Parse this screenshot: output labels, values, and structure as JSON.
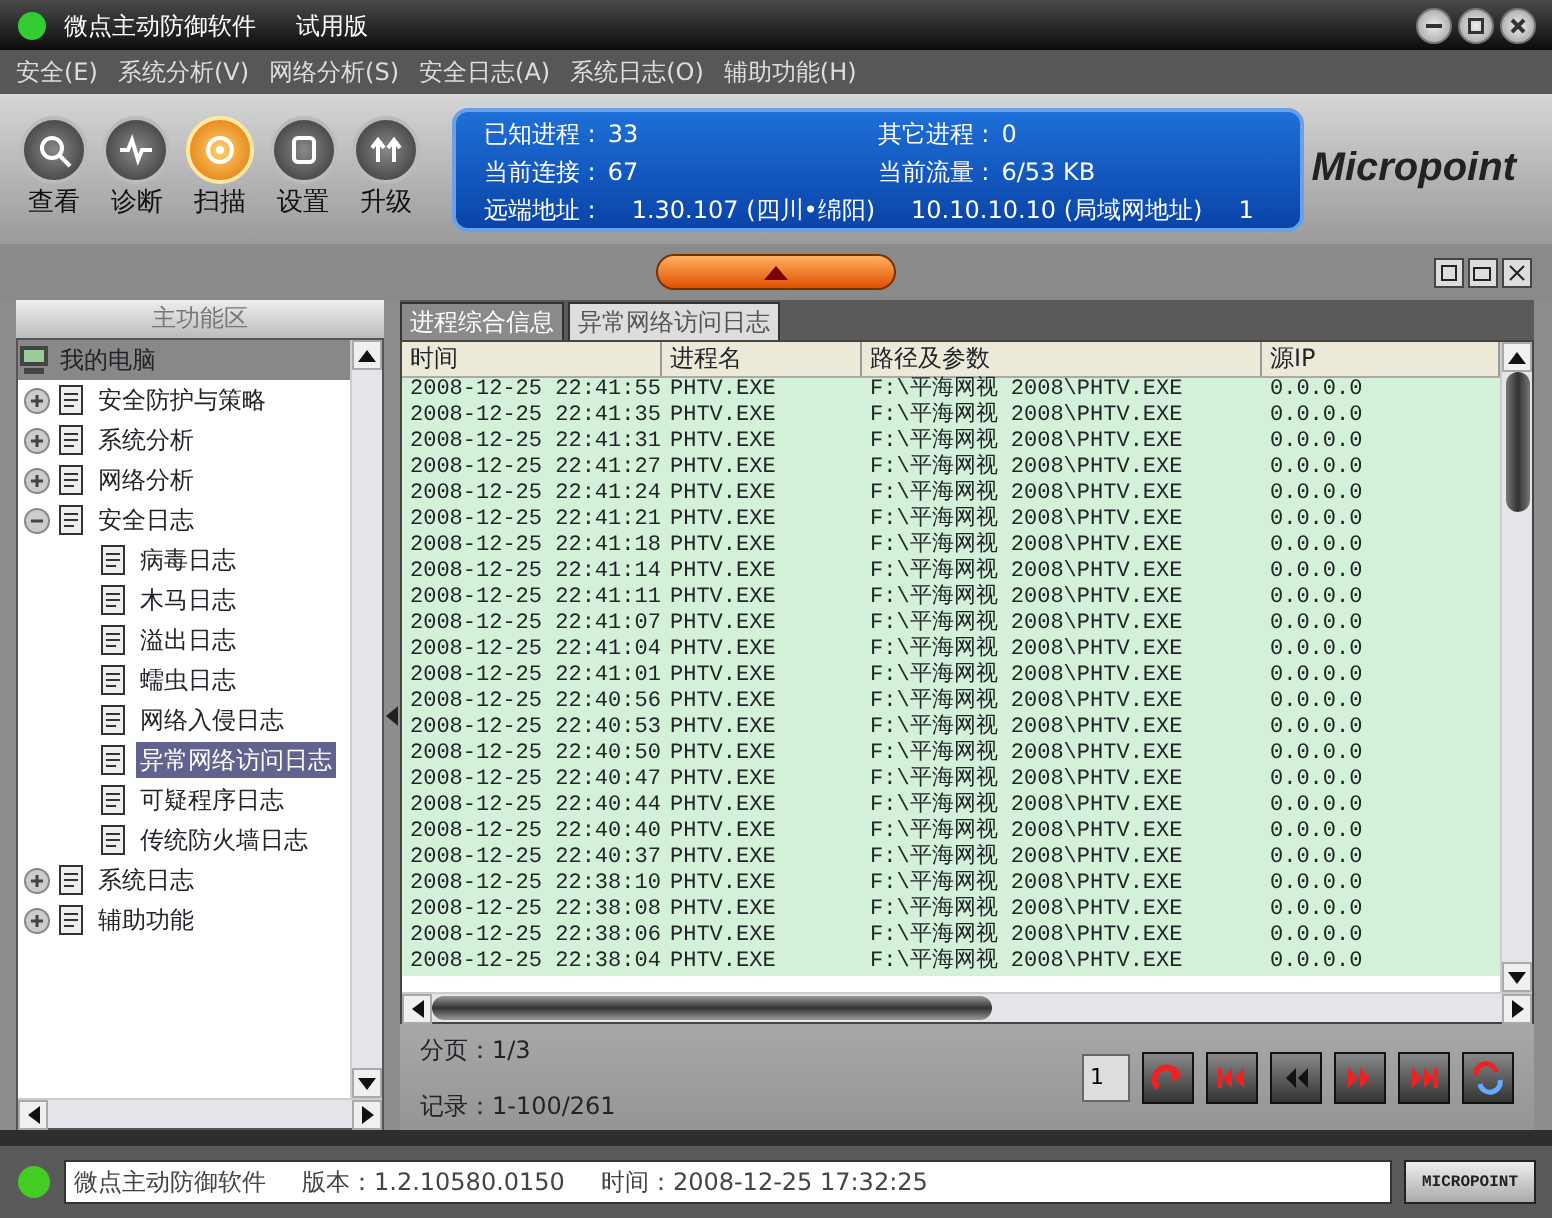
{
  "window": {
    "title": "微点主动防御软件",
    "edition": "试用版"
  },
  "menu": [
    "安全(E)",
    "系统分析(V)",
    "网络分析(S)",
    "安全日志(A)",
    "系统日志(O)",
    "辅助功能(H)"
  ],
  "toolbar": [
    {
      "label": "查看",
      "kind": "view",
      "selected": false
    },
    {
      "label": "诊断",
      "kind": "diagnose",
      "selected": false
    },
    {
      "label": "扫描",
      "kind": "scan",
      "selected": true
    },
    {
      "label": "设置",
      "kind": "settings",
      "selected": false
    },
    {
      "label": "升级",
      "kind": "upgrade",
      "selected": false
    }
  ],
  "info_panel": {
    "fields": [
      {
        "label": "已知进程 :",
        "value": "33"
      },
      {
        "label": "其它进程 :",
        "value": "0"
      },
      {
        "label": "当前连接 :",
        "value": "67"
      },
      {
        "label": "当前流量 :",
        "value": "6/53 KB"
      }
    ],
    "remote": {
      "label": "远端地址 :",
      "values": [
        "1.30.107 (四川•绵阳)",
        "10.10.10.10 (局域网地址)",
        "1"
      ]
    }
  },
  "logo": "Micropoint",
  "sidebar": {
    "title": "主功能区",
    "tree": {
      "label": "我的电脑",
      "children": [
        {
          "label": "安全防护与策略",
          "expanded": false
        },
        {
          "label": "系统分析",
          "expanded": false
        },
        {
          "label": "网络分析",
          "expanded": false
        },
        {
          "label": "安全日志",
          "expanded": true,
          "children": [
            {
              "label": "病毒日志",
              "selected": false
            },
            {
              "label": "木马日志",
              "selected": false
            },
            {
              "label": "溢出日志",
              "selected": false
            },
            {
              "label": "蠕虫日志",
              "selected": false
            },
            {
              "label": "网络入侵日志",
              "selected": false
            },
            {
              "label": "异常网络访问日志",
              "selected": true
            },
            {
              "label": "可疑程序日志",
              "selected": false
            },
            {
              "label": "传统防火墙日志",
              "selected": false
            }
          ]
        },
        {
          "label": "系统日志",
          "expanded": false
        },
        {
          "label": "辅助功能",
          "expanded": false
        }
      ]
    }
  },
  "tabs": [
    {
      "label": "进程综合信息",
      "selected": false
    },
    {
      "label": "异常网络访问日志",
      "selected": true
    }
  ],
  "table": {
    "columns": [
      "时间",
      "进程名",
      "路径及参数",
      "源IP"
    ],
    "rows": [
      [
        "2008-12-25 22:41:55",
        "PHTV.EXE",
        "F:\\平海网视 2008\\PHTV.EXE",
        "0.0.0.0"
      ],
      [
        "2008-12-25 22:41:35",
        "PHTV.EXE",
        "F:\\平海网视 2008\\PHTV.EXE",
        "0.0.0.0"
      ],
      [
        "2008-12-25 22:41:31",
        "PHTV.EXE",
        "F:\\平海网视 2008\\PHTV.EXE",
        "0.0.0.0"
      ],
      [
        "2008-12-25 22:41:27",
        "PHTV.EXE",
        "F:\\平海网视 2008\\PHTV.EXE",
        "0.0.0.0"
      ],
      [
        "2008-12-25 22:41:24",
        "PHTV.EXE",
        "F:\\平海网视 2008\\PHTV.EXE",
        "0.0.0.0"
      ],
      [
        "2008-12-25 22:41:21",
        "PHTV.EXE",
        "F:\\平海网视 2008\\PHTV.EXE",
        "0.0.0.0"
      ],
      [
        "2008-12-25 22:41:18",
        "PHTV.EXE",
        "F:\\平海网视 2008\\PHTV.EXE",
        "0.0.0.0"
      ],
      [
        "2008-12-25 22:41:14",
        "PHTV.EXE",
        "F:\\平海网视 2008\\PHTV.EXE",
        "0.0.0.0"
      ],
      [
        "2008-12-25 22:41:11",
        "PHTV.EXE",
        "F:\\平海网视 2008\\PHTV.EXE",
        "0.0.0.0"
      ],
      [
        "2008-12-25 22:41:07",
        "PHTV.EXE",
        "F:\\平海网视 2008\\PHTV.EXE",
        "0.0.0.0"
      ],
      [
        "2008-12-25 22:41:04",
        "PHTV.EXE",
        "F:\\平海网视 2008\\PHTV.EXE",
        "0.0.0.0"
      ],
      [
        "2008-12-25 22:41:01",
        "PHTV.EXE",
        "F:\\平海网视 2008\\PHTV.EXE",
        "0.0.0.0"
      ],
      [
        "2008-12-25 22:40:56",
        "PHTV.EXE",
        "F:\\平海网视 2008\\PHTV.EXE",
        "0.0.0.0"
      ],
      [
        "2008-12-25 22:40:53",
        "PHTV.EXE",
        "F:\\平海网视 2008\\PHTV.EXE",
        "0.0.0.0"
      ],
      [
        "2008-12-25 22:40:50",
        "PHTV.EXE",
        "F:\\平海网视 2008\\PHTV.EXE",
        "0.0.0.0"
      ],
      [
        "2008-12-25 22:40:47",
        "PHTV.EXE",
        "F:\\平海网视 2008\\PHTV.EXE",
        "0.0.0.0"
      ],
      [
        "2008-12-25 22:40:44",
        "PHTV.EXE",
        "F:\\平海网视 2008\\PHTV.EXE",
        "0.0.0.0"
      ],
      [
        "2008-12-25 22:40:40",
        "PHTV.EXE",
        "F:\\平海网视 2008\\PHTV.EXE",
        "0.0.0.0"
      ],
      [
        "2008-12-25 22:40:37",
        "PHTV.EXE",
        "F:\\平海网视 2008\\PHTV.EXE",
        "0.0.0.0"
      ],
      [
        "2008-12-25 22:38:10",
        "PHTV.EXE",
        "F:\\平海网视 2008\\PHTV.EXE",
        "0.0.0.0"
      ],
      [
        "2008-12-25 22:38:08",
        "PHTV.EXE",
        "F:\\平海网视 2008\\PHTV.EXE",
        "0.0.0.0"
      ],
      [
        "2008-12-25 22:38:06",
        "PHTV.EXE",
        "F:\\平海网视 2008\\PHTV.EXE",
        "0.0.0.0"
      ],
      [
        "2008-12-25 22:38:04",
        "PHTV.EXE",
        "F:\\平海网视 2008\\PHTV.EXE",
        "0.0.0.0"
      ]
    ]
  },
  "pager": {
    "page": "分页：1/3",
    "records": "记录：1-100/261",
    "page_input": "1"
  },
  "status_bar": {
    "app": "微点主动防御软件",
    "version": "版本：1.2.10580.0150",
    "time": "时间：2008-12-25 17:32:25",
    "logo": "MICROPOINT"
  }
}
